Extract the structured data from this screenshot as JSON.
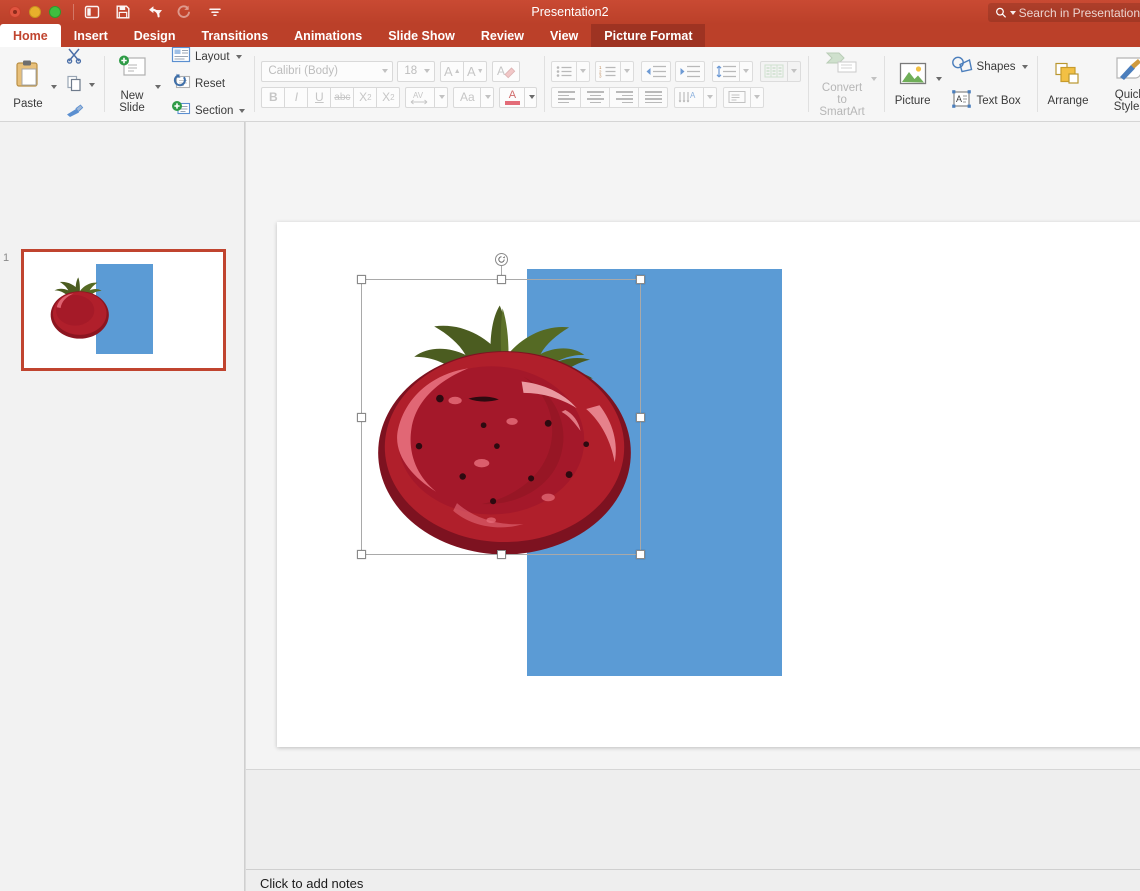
{
  "window": {
    "title": "Presentation2",
    "traffic_lights": [
      "close",
      "minimize",
      "maximize"
    ],
    "quick_access": [
      {
        "name": "sidebar-toggle-icon",
        "label": "Sidebar"
      },
      {
        "name": "save-icon",
        "label": "Save"
      },
      {
        "name": "undo-icon",
        "label": "Undo"
      },
      {
        "name": "redo-icon",
        "label": "Redo"
      },
      {
        "name": "customize-toolbar-icon",
        "label": "Customize Toolbar"
      }
    ],
    "search": {
      "placeholder": "Search in Presentation",
      "icon": "search-icon"
    }
  },
  "tabs": [
    {
      "label": "Home",
      "state": "active"
    },
    {
      "label": "Insert",
      "state": "normal"
    },
    {
      "label": "Design",
      "state": "normal"
    },
    {
      "label": "Transitions",
      "state": "normal"
    },
    {
      "label": "Animations",
      "state": "normal"
    },
    {
      "label": "Slide Show",
      "state": "normal"
    },
    {
      "label": "Review",
      "state": "normal"
    },
    {
      "label": "View",
      "state": "normal"
    },
    {
      "label": "Picture Format",
      "state": "contextual"
    }
  ],
  "ribbon": {
    "clipboard": {
      "paste_label": "Paste",
      "cut_label": "Cut",
      "copy_label": "Copy",
      "format_painter_label": "Format Painter"
    },
    "slides": {
      "new_slide_line1": "New",
      "new_slide_line2": "Slide",
      "layout_label": "Layout",
      "reset_label": "Reset",
      "section_label": "Section"
    },
    "font": {
      "font_name": "Calibri (Body)",
      "font_size": "18",
      "grow_label": "A",
      "shrink_label": "A",
      "clear_formatting_label": "A",
      "bold_label": "B",
      "italic_label": "I",
      "underline_label": "U",
      "strikethrough_label": "abc",
      "superscript_label": "X",
      "subscript_label": "X",
      "character_spacing_label": "AV",
      "change_case_label": "Aa",
      "font_color_label": "A",
      "enabled": false
    },
    "paragraph": {
      "bullets_label": "Bullets",
      "numbering_label": "Numbering",
      "decrease_indent_label": "Decrease Indent",
      "increase_indent_label": "Increase Indent",
      "line_spacing_label": "Line Spacing",
      "columns_label": "Columns",
      "align_left_label": "Align Left",
      "align_center_label": "Center",
      "align_right_label": "Align Right",
      "justify_label": "Justify",
      "text_direction_label": "Text Direction",
      "align_text_label": "Align Text"
    },
    "smartart": {
      "line1": "Convert to",
      "line2": "SmartArt"
    },
    "insert": {
      "picture_label": "Picture",
      "shapes_label": "Shapes",
      "textbox_label": "Text Box"
    },
    "arrange": {
      "label": "Arrange"
    },
    "quick_styles": {
      "line1": "Quick",
      "line2": "Styles"
    }
  },
  "slide_panel": {
    "slides": [
      {
        "number": "1",
        "selected": true
      }
    ]
  },
  "notes": {
    "placeholder": "Click to add notes"
  },
  "colors": {
    "accent_red": "#c0442f",
    "contextual_tab": "#9e3322",
    "rectangle_blue": "#5b9bd5",
    "tomato_red": "#b01f2b",
    "tomato_dark": "#8c1520",
    "leaf_green": "#4b5c20",
    "ribbon_bg": "#f6f6f6",
    "panel_bg": "#f2f2f2",
    "canvas_bg": "#f4f4f4"
  },
  "canvas": {
    "shapes": [
      {
        "name": "blue-rectangle",
        "fill": "#5b9bd5"
      },
      {
        "name": "tomato-picture",
        "selected": true
      }
    ]
  }
}
